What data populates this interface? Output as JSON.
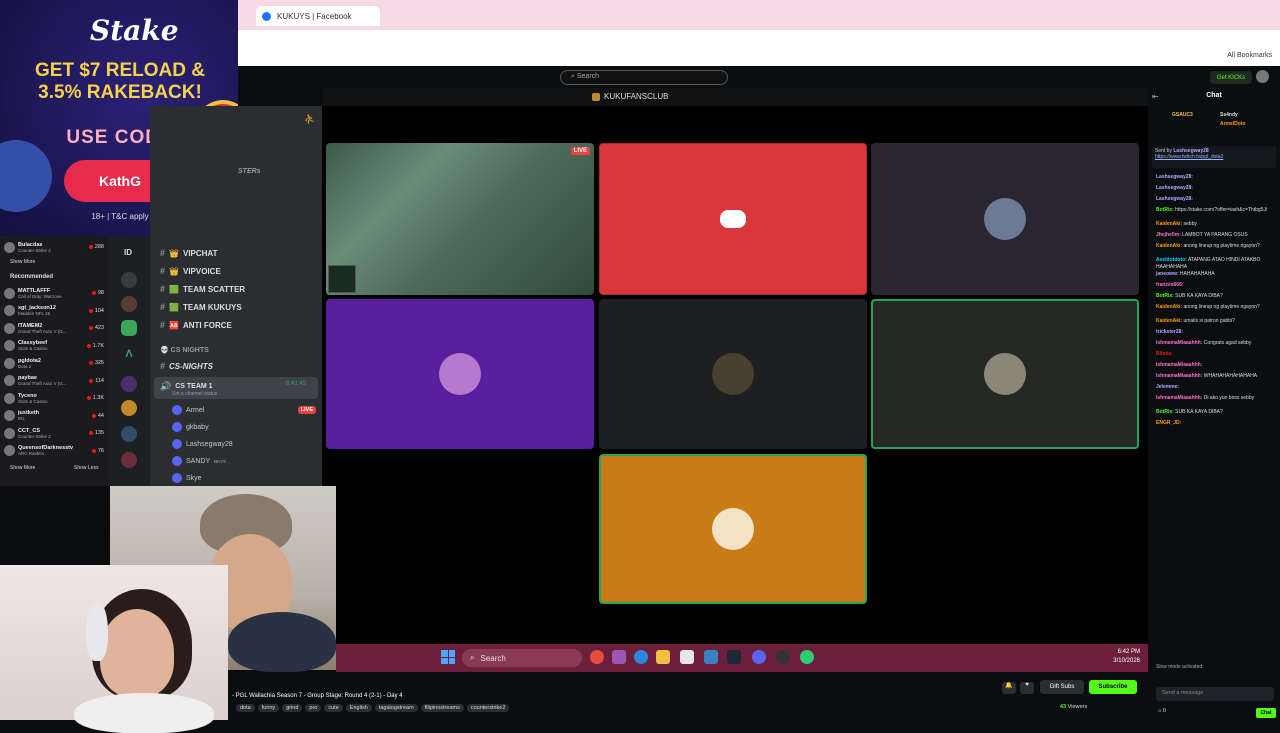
{
  "browser": {
    "tab_title": "KUKUYS | Facebook",
    "bookmarks_label": "All Bookmarks"
  },
  "kick": {
    "search_placeholder": "Search",
    "get_kicks": "Get KICKs"
  },
  "ad": {
    "logo": "Stake",
    "headline": "GET $7 RELOAD & 3.5% RAKEBACK!",
    "use_code": "USE CODE",
    "code": "KathG",
    "terms": "18+ | T&C apply"
  },
  "sidebar": {
    "top_item": {
      "name": "Bulacdas",
      "game": "Counter-Strike 2",
      "count": "288"
    },
    "show_more_label": "Show More",
    "recommended_label": "Recommended",
    "recommended": [
      {
        "name": "MATTLAFFF",
        "game": "Call of Duty: Warzone",
        "count": "98"
      },
      {
        "name": "sgt_jackson12",
        "game": "Madden NFL 26",
        "count": "104"
      },
      {
        "name": "ITAMEM2",
        "game": "Grand Theft Auto V (G...",
        "count": "423"
      },
      {
        "name": "Classybeef",
        "game": "Slots & Casino",
        "count": "1.7K"
      },
      {
        "name": "pgldota2",
        "game": "Dota 2",
        "count": "325"
      },
      {
        "name": "paybae",
        "game": "Grand Theft Auto V (G...",
        "count": "114"
      },
      {
        "name": "Tyceno",
        "game": "Slots & Casino",
        "count": "1.3K"
      },
      {
        "name": "justketh",
        "game": "IRL",
        "count": "44"
      },
      {
        "name": "CCT_CS",
        "game": "Counter-Strike 2",
        "count": "135"
      },
      {
        "name": "QueensofDarknesstv",
        "game": "ARC Raiders",
        "count": "76"
      }
    ],
    "show_less_label": "Show Less"
  },
  "discord": {
    "server_name": "KUKUFANSCLUB",
    "masters_label": "STERs",
    "server_id_label": "ID",
    "channels": [
      {
        "label": "VIPCHAT",
        "emoji": "👑"
      },
      {
        "label": "VIPVOICE",
        "emoji": "👑"
      },
      {
        "label": "TEAM SCATTER",
        "emoji": "🟩"
      },
      {
        "label": "TEAM KUKUYS",
        "emoji": "🟩"
      },
      {
        "label": "ANTI FORCE",
        "emoji": "🆎"
      }
    ],
    "category": "CS NIGHTS",
    "sub_channel": "CS-NIGHTS",
    "voice_channel": "CS TEAM 1",
    "voice_timer": "6:41:45",
    "channel_status": "Set a channel status",
    "voice_users": [
      {
        "name": "Armel",
        "live": "LIVE"
      },
      {
        "name": "gkbaby"
      },
      {
        "name": "Lashsegway28"
      },
      {
        "name": "SANDY",
        "tag": "BKYS"
      },
      {
        "name": "Skye"
      }
    ],
    "live_badge": "LIVE"
  },
  "taskbar": {
    "search_label": "Search",
    "time": "6:42 PM",
    "date": "3/10/2026"
  },
  "stream": {
    "title": "- PGL Wallachia Season 7 - Group Stage: Round 4 (2-1) - Day 4",
    "tags": [
      "dota",
      "funny",
      "grind",
      "pro",
      "cute",
      "English",
      "tagalogstream",
      "filipinostreams",
      "counterstrike2"
    ],
    "gift_subs": "Gift Subs",
    "subscribe": "Subscribe",
    "viewers_count": "43",
    "viewers_label": "Viewers"
  },
  "chat": {
    "title": "Chat",
    "pinned_top": [
      {
        "user": "GSAUC3",
        "count": "5"
      },
      {
        "user": "Ss4ndy",
        "count": "5"
      },
      {
        "user": "ArmelDoto",
        "count": "5"
      }
    ],
    "pinned_sent_by_label": "Sent by",
    "pinned_sender": "Lashsegway28",
    "pinned_link": "https://www.twitch.tv/pgl_dota2",
    "messages": [
      {
        "user": "Lashsegway28:",
        "text": "",
        "color": "#b9a6ff"
      },
      {
        "user": "Lashsegway28:",
        "text": "",
        "color": "#b9a6ff"
      },
      {
        "user": "Lashsegway28:",
        "text": "",
        "color": "#b9a6ff"
      },
      {
        "user": "BotRix:",
        "text": "https://stake.com/?offer=iash&c=Thtbg5Ji",
        "color": "#53fc18"
      },
      {
        "user": "KaidenAki:",
        "text": "sebby",
        "color": "#ff9d00"
      },
      {
        "user": "Jhejhe0m:",
        "text": "LAMBOT YA PARANG OSUS",
        "color": "#ff6ec7"
      },
      {
        "user": "KaidenAki:",
        "text": "anong lineup ng playtime ngayon?",
        "color": "#ff9d00"
      },
      {
        "user": "Axeldotdoto:",
        "text": "ATAPANG ATAO HINDI ATAKBO HAAHAHAHA",
        "color": "#00d4ff"
      },
      {
        "user": "janeoww:",
        "text": "HAHAHAHAHA",
        "color": "#b9a6ff"
      },
      {
        "user": "franzes666:",
        "text": "",
        "color": "#ff6ec7"
      },
      {
        "user": "BotRix:",
        "text": "SUB KA KAYA DIBA?",
        "color": "#53fc18"
      },
      {
        "user": "KaidenAki:",
        "text": "anong lineup ng playtime ngayon?",
        "color": "#ff9d00"
      },
      {
        "user": "KaidenAki:",
        "text": "umalis si patron gabbi?",
        "color": "#ff9d00"
      },
      {
        "user": "trickster28:",
        "text": "",
        "color": "#b9a6ff"
      },
      {
        "user": "IshmamaMiaaahhh:",
        "text": "Congrats agad sebby",
        "color": "#ff6ec7"
      },
      {
        "user": "Blinde:",
        "text": "",
        "color": "#e91916"
      },
      {
        "user": "IshmamaMiaaahhh:",
        "text": "",
        "color": "#ff6ec7"
      },
      {
        "user": "IshmamaMiaaahhh:",
        "text": "WHAHAHAHAHAHAHA",
        "color": "#ff6ec7"
      },
      {
        "user": "Jelemme:",
        "text": "",
        "color": "#b9a6ff"
      },
      {
        "user": "IshmamaMiaaahhh:",
        "text": "Di ako yun boss sebby",
        "color": "#ff6ec7"
      },
      {
        "user": "BotRix:",
        "text": "SUB KA KAYA DIBA?",
        "color": "#53fc18"
      },
      {
        "user": "ENGR_JD:",
        "text": "",
        "color": "#ff9d00"
      }
    ],
    "slow_mode": "Slow mode activated",
    "input_placeholder": "Send a message",
    "send_label": "Chat",
    "points": "0"
  }
}
